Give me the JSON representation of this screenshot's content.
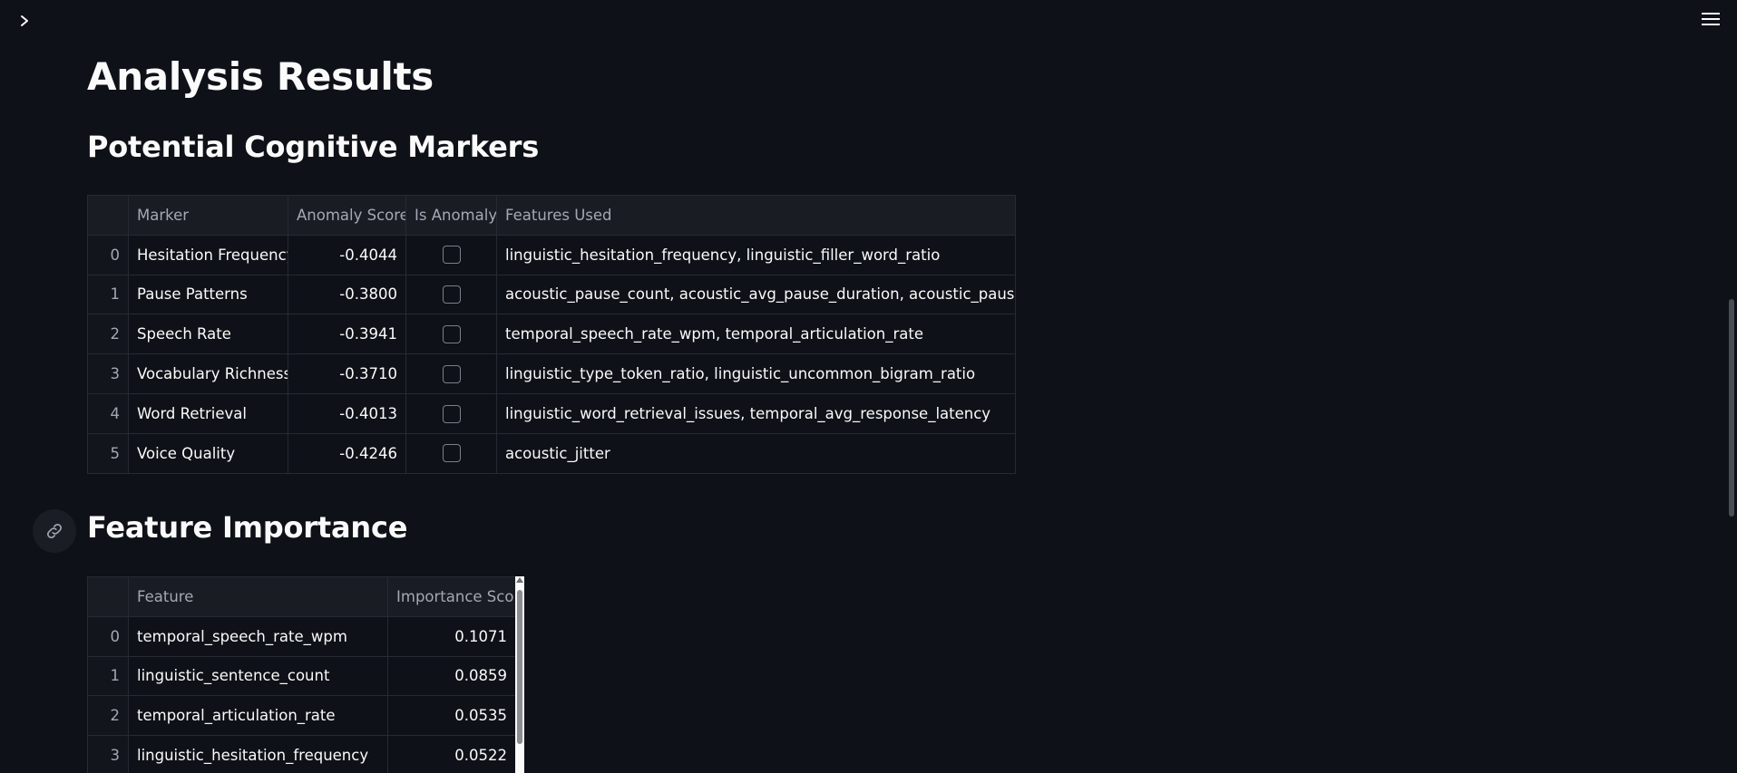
{
  "page": {
    "title": "Analysis Results"
  },
  "markers": {
    "heading": "Potential Cognitive Markers",
    "columns": [
      "",
      "Marker",
      "Anomaly Score",
      "Is Anomaly",
      "Features Used"
    ],
    "rows": [
      {
        "index": "0",
        "marker": "Hesitation Frequency",
        "score": "-0.4044",
        "is_anomaly": false,
        "features": "linguistic_hesitation_frequency, linguistic_filler_word_ratio"
      },
      {
        "index": "1",
        "marker": "Pause Patterns",
        "score": "-0.3800",
        "is_anomaly": false,
        "features": "acoustic_pause_count, acoustic_avg_pause_duration, acoustic_pause_rate"
      },
      {
        "index": "2",
        "marker": "Speech Rate",
        "score": "-0.3941",
        "is_anomaly": false,
        "features": "temporal_speech_rate_wpm, temporal_articulation_rate"
      },
      {
        "index": "3",
        "marker": "Vocabulary Richness",
        "score": "-0.3710",
        "is_anomaly": false,
        "features": "linguistic_type_token_ratio, linguistic_uncommon_bigram_ratio"
      },
      {
        "index": "4",
        "marker": "Word Retrieval",
        "score": "-0.4013",
        "is_anomaly": false,
        "features": "linguistic_word_retrieval_issues, temporal_avg_response_latency"
      },
      {
        "index": "5",
        "marker": "Voice Quality",
        "score": "-0.4246",
        "is_anomaly": false,
        "features": "acoustic_jitter"
      }
    ]
  },
  "importance": {
    "heading": "Feature Importance",
    "columns": [
      "",
      "Feature",
      "Importance Score"
    ],
    "rows": [
      {
        "index": "0",
        "feature": "temporal_speech_rate_wpm",
        "score": "0.1071"
      },
      {
        "index": "1",
        "feature": "linguistic_sentence_count",
        "score": "0.0859"
      },
      {
        "index": "2",
        "feature": "temporal_articulation_rate",
        "score": "0.0535"
      },
      {
        "index": "3",
        "feature": "linguistic_hesitation_frequency",
        "score": "0.0522"
      }
    ]
  },
  "icons": {
    "sidebar_toggle": "chevron-right-icon",
    "menu": "hamburger-menu-icon",
    "anchor": "link-icon"
  },
  "colors": {
    "background": "#0e1117",
    "text": "#fafafa",
    "header_bg": "#1a1c23",
    "border": "#262a33"
  }
}
